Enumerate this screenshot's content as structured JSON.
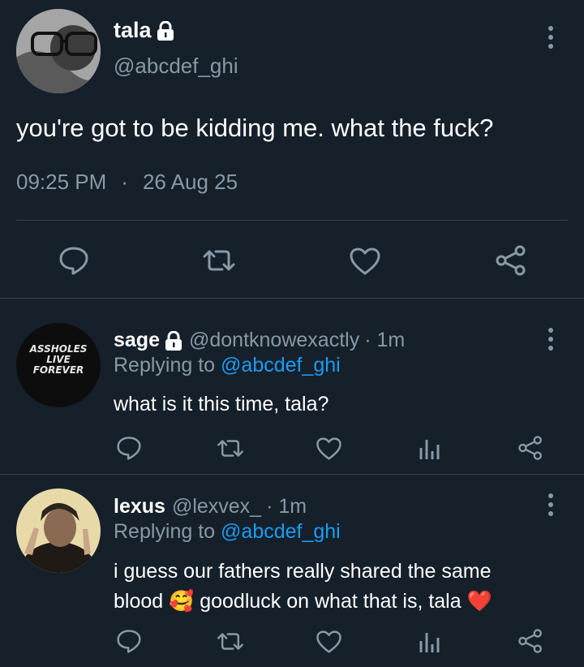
{
  "main_tweet": {
    "display_name": "tala",
    "handle": "@abcdef_ghi",
    "text": "you're got to be kidding me. what the fuck?",
    "time": "09:25 PM",
    "separator": "·",
    "date": "26 Aug 25"
  },
  "replies": [
    {
      "display_name": "sage",
      "handle": "@dontknowexactly",
      "age": "· 1m",
      "replying_prefix": "Replying to",
      "replying_handle": "@abcdef_ghi",
      "text": "what is it this time, tala?",
      "avatar_text": [
        "ASSHOLES",
        "LIVE",
        "FOREVER"
      ]
    },
    {
      "display_name": "lexus",
      "handle": "@lexvex_",
      "age": "· 1m",
      "replying_prefix": "Replying to",
      "replying_handle": "@abcdef_ghi",
      "text_line1": "i guess our fathers really shared the same",
      "text_line2_a": "blood",
      "emoji_1": "🥰",
      "text_line2_b": "goodluck on what that is, tala",
      "emoji_2": "❤️"
    }
  ],
  "icons": {
    "reply": "reply-icon",
    "retweet": "retweet-icon",
    "like": "like-icon",
    "share": "share-icon",
    "analytics": "analytics-icon",
    "lock": "lock-icon",
    "more": "more-icon"
  },
  "colors": {
    "background": "#15202b",
    "muted": "#8899a6",
    "link": "#1d9bf0",
    "divider": "#38444d"
  }
}
